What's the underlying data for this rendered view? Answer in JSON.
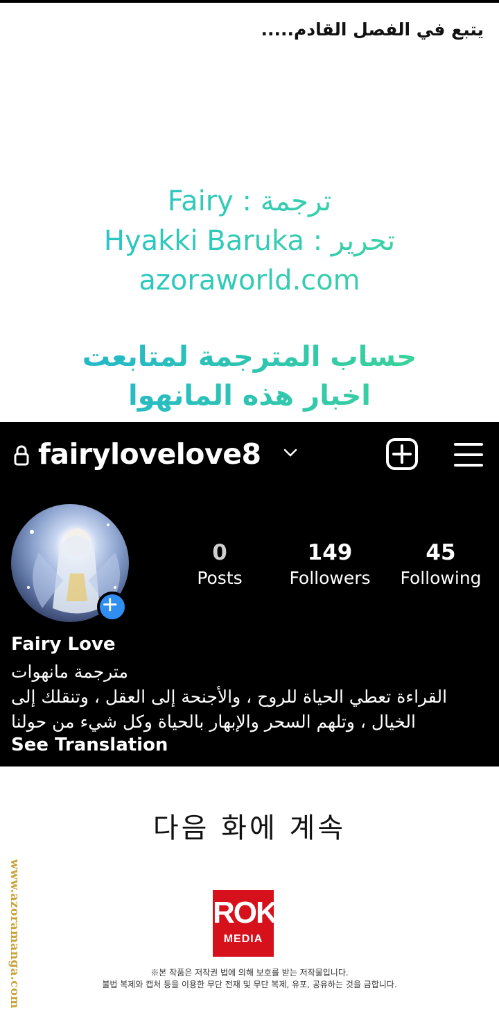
{
  "page": {
    "continue_arabic": "يتبع في الفصل القادم.....",
    "credits": {
      "translation": "Fairy : ترجمة",
      "editing": "Hyakki Baruka : تحرير",
      "website": "azoraworld.com"
    },
    "follow_note": {
      "line1": "حساب المترجمة لمتابعت",
      "line2": "اخبار هذه المانهوا"
    }
  },
  "instagram": {
    "username": "fairylovelove8",
    "stats": [
      {
        "value": "0",
        "label": "Posts"
      },
      {
        "value": "149",
        "label": "Followers"
      },
      {
        "value": "45",
        "label": "Following"
      }
    ],
    "display_name": "Fairy Love",
    "bio_line1": "مترجمة مانهوات",
    "bio_line2": "القراءة تعطي الحياة للروح ، والأجنحة إلى العقل ، وتنقلك إلى",
    "bio_line3": "الخيال ، وتلهم السحر والإبهار بالحياة وكل شيء من حولنا",
    "see_translation": "See Translation",
    "icons": {
      "lock": "lock-icon",
      "dropdown": "chevron-down-icon",
      "add": "add-post-icon",
      "menu": "menu-icon",
      "avatar_badge": "plus-icon"
    }
  },
  "footer": {
    "korean_continue": "다음 화에 계속",
    "publisher_logo_main": "ROK",
    "publisher_logo_sub": "MEDIA",
    "copyright_line1": "※본 작품은 저작권 법에 의해 보호를 받는 저작물입니다.",
    "copyright_line2": "불법 복제와 캡처 등을 이용한 무단 전재 및 무단 복제, 유포, 공유하는 것을 금합니다.",
    "watermark": "www.azoramanga.com"
  },
  "colors": {
    "credit_teal": "#2bc9b6",
    "instagram_bg": "#000000",
    "badge_blue": "#2f8ef0",
    "rok_red": "#d7111b",
    "watermark_gold": "#c9a43a"
  }
}
